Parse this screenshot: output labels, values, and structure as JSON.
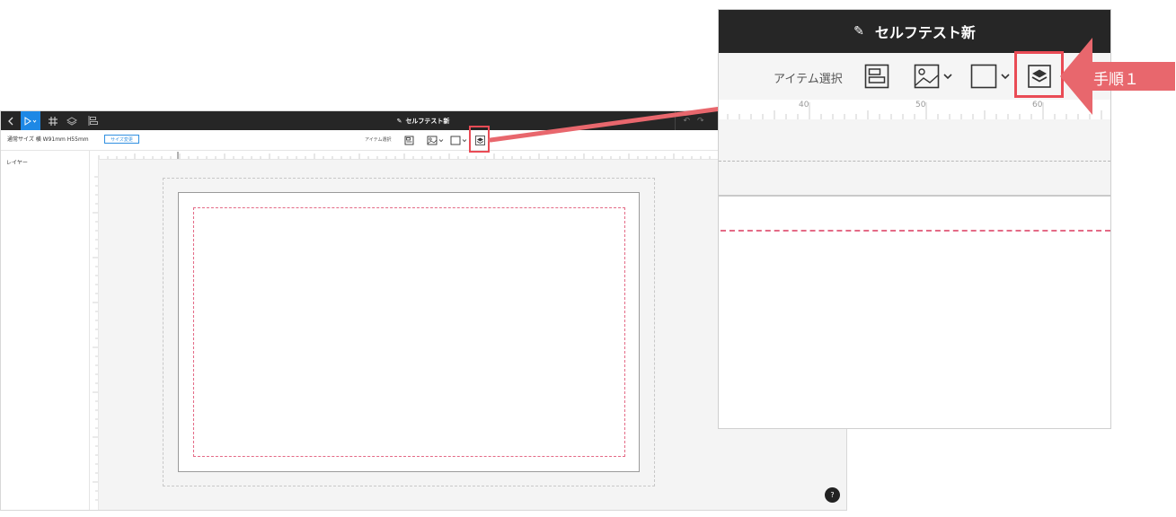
{
  "app": {
    "title": "セルフテスト新",
    "size_label": "通常サイズ 横 W91mm H55mm",
    "size_change_button": "サイズ変更",
    "item_select_label": "アイテム選択",
    "layer_panel_label": "レイヤー",
    "help_label": "?"
  },
  "zoom": {
    "title": "セルフテスト新",
    "item_select_label": "アイテム選択",
    "ruler_numbers": [
      "40",
      "50",
      "60"
    ]
  },
  "callout": {
    "step_label": "手順１",
    "color": "#e8676d"
  },
  "colors": {
    "topbar": "#262626",
    "accent_blue": "#1e88e5",
    "highlight_red": "#e94b55",
    "safe_line_pink": "#e46a86"
  }
}
